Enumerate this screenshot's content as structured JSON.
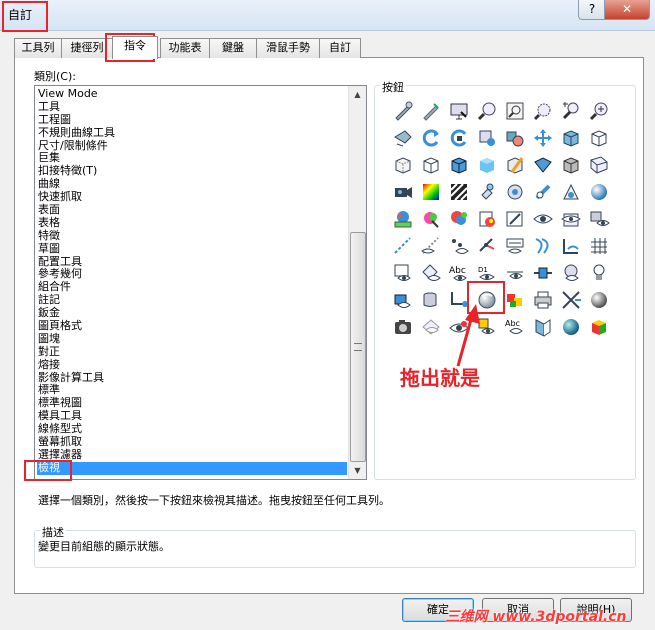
{
  "window": {
    "title": "自訂",
    "help_glyph": "?",
    "close_glyph": "✕"
  },
  "tabs": [
    {
      "label": "工具列"
    },
    {
      "label": "捷徑列"
    },
    {
      "label": "指令",
      "active": true
    },
    {
      "label": "功能表"
    },
    {
      "label": "鍵盤"
    },
    {
      "label": "滑鼠手勢"
    },
    {
      "label": "自訂"
    }
  ],
  "categories": {
    "label": "類別(C):",
    "items": [
      "View Mode",
      "工具",
      "工程圖",
      "不規則曲線工具",
      "尺寸/限制條件",
      "巨集",
      "扣接特徵(T)",
      "曲線",
      "快速抓取",
      "表面",
      "表格",
      "特徵",
      "草圖",
      "配置工具",
      "參考幾何",
      "組合件",
      "註記",
      "鈑金",
      "圖頁格式",
      "圖塊",
      "對正",
      "熔接",
      "影像計算工具",
      "標準",
      "標準視圖",
      "模具工具",
      "線條型式",
      "螢幕抓取",
      "選擇濾器",
      "檢視"
    ],
    "selected": "檢視"
  },
  "buttons_group": {
    "title": "按鈕"
  },
  "icon_text": {
    "abc": "Abc",
    "d1": "D1",
    "abc2": "Abc"
  },
  "hint": "選擇一個類別，然後按一下按鈕來檢視其描述。拖曳按鈕至任何工具列。",
  "description": {
    "title": "描述",
    "text": "變更目前組態的顯示狀態。"
  },
  "footer": {
    "ok": "確定",
    "cancel": "取消",
    "help": "說明(H)"
  },
  "annotation": "拖出就是",
  "watermark": "三维网 www.3dportal.cn",
  "colors": {
    "accent_red": "#e8232a",
    "selection": "#3399ff",
    "icon_blue": "#3a8fd6"
  }
}
